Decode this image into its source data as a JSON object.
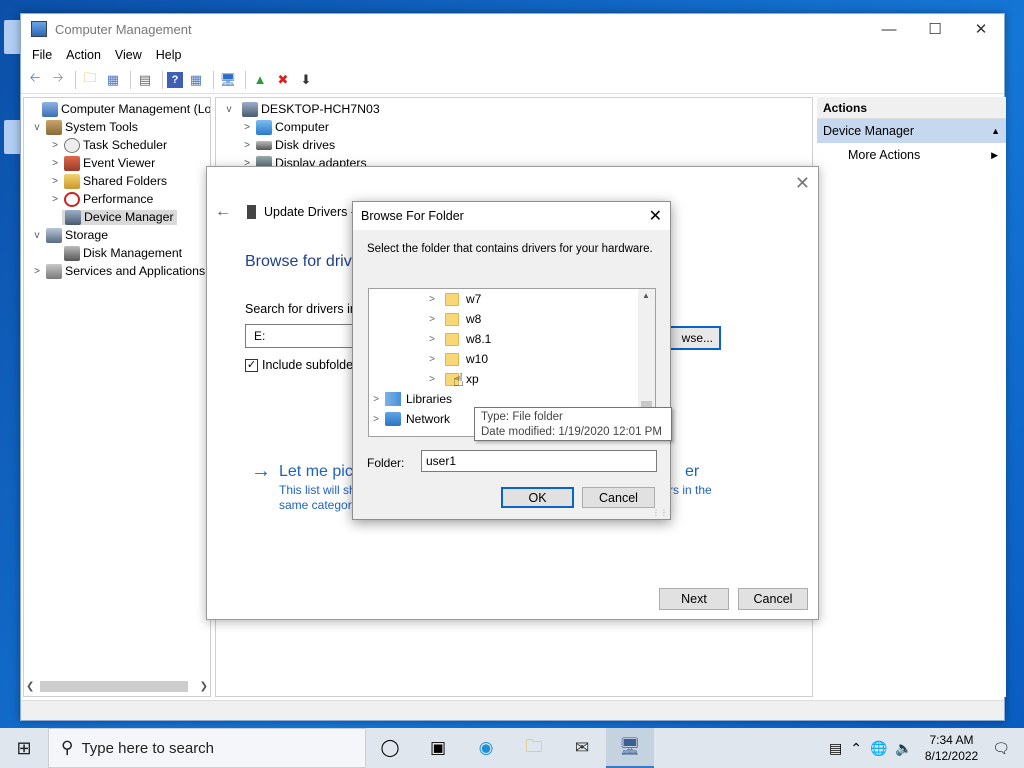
{
  "window": {
    "title": "Computer Management"
  },
  "menu": [
    "File",
    "Action",
    "View",
    "Help"
  ],
  "tree": [
    {
      "label": "Computer Management (Local",
      "level": 0,
      "expander": ""
    },
    {
      "label": "System Tools",
      "level": 1,
      "expander": "v"
    },
    {
      "label": "Task Scheduler",
      "level": 2,
      "expander": ">"
    },
    {
      "label": "Event Viewer",
      "level": 2,
      "expander": ">"
    },
    {
      "label": "Shared Folders",
      "level": 2,
      "expander": ">"
    },
    {
      "label": "Performance",
      "level": 2,
      "expander": ">"
    },
    {
      "label": "Device Manager",
      "level": 2,
      "expander": ""
    },
    {
      "label": "Storage",
      "level": 1,
      "expander": "v"
    },
    {
      "label": "Disk Management",
      "level": 2,
      "expander": ""
    },
    {
      "label": "Services and Applications",
      "level": 1,
      "expander": ">"
    }
  ],
  "device_tree": {
    "root": "DESKTOP-HCH7N03",
    "items": [
      "Computer",
      "Disk drives",
      "Display adapters"
    ]
  },
  "actions": {
    "header": "Actions",
    "device_manager": "Device Manager",
    "more_actions": "More Actions"
  },
  "wizard": {
    "title": "Update Drivers -",
    "heading": "Browse for drive",
    "search_label": "Search for drivers in",
    "path_value": "E:",
    "browse_label": "wse...",
    "include_subfolders": "Include subfolder",
    "pick_text": "Let me pick",
    "pick_tail": "er",
    "pick_desc_1": "This list will sh",
    "pick_desc_2": "same category",
    "pick_desc_tail": "rs in the",
    "next": "Next",
    "cancel": "Cancel"
  },
  "browse_folder": {
    "title": "Browse For Folder",
    "description": "Select the folder that contains drivers for your hardware.",
    "folders": [
      "w7",
      "w8",
      "w8.1",
      "w10",
      "xp"
    ],
    "libraries": "Libraries",
    "network": "Network",
    "folder_label": "Folder:",
    "folder_value": "user1",
    "ok": "OK",
    "cancel": "Cancel",
    "tooltip_type": "Type: File folder",
    "tooltip_date": "Date modified: 1/19/2020 12:01 PM"
  },
  "taskbar": {
    "search_placeholder": "Type here to search",
    "time": "7:34 AM",
    "date": "8/12/2022"
  }
}
